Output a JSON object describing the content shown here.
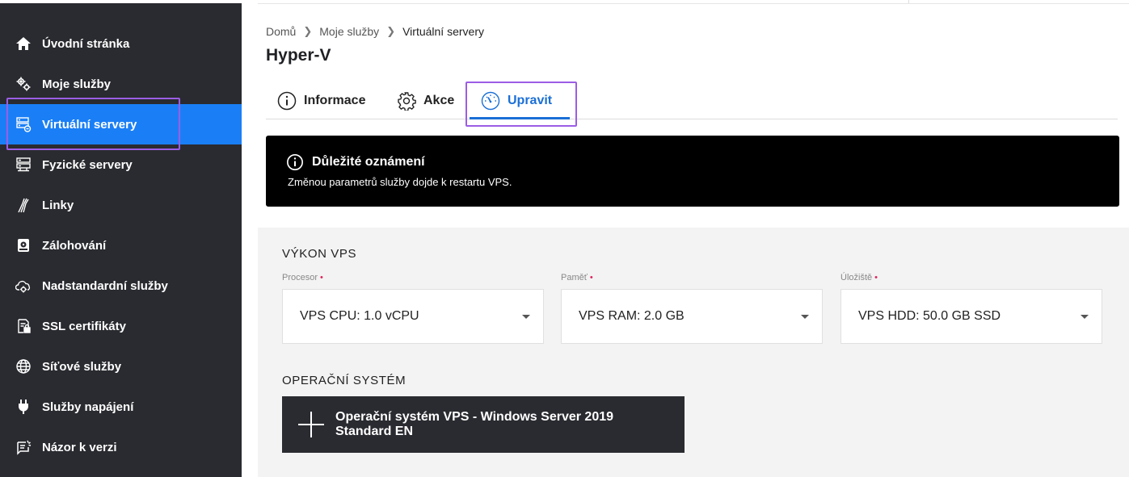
{
  "sidebar": {
    "items": [
      {
        "label": "Úvodní stránka",
        "icon": "home-icon"
      },
      {
        "label": "Moje služby",
        "icon": "gears-icon"
      },
      {
        "label": "Virtuální servery",
        "icon": "virtual-server-icon",
        "active": true
      },
      {
        "label": "Fyzické servery",
        "icon": "server-icon"
      },
      {
        "label": "Linky",
        "icon": "fiber-icon"
      },
      {
        "label": "Zálohování",
        "icon": "backup-drive-icon"
      },
      {
        "label": "Nadstandardní služby",
        "icon": "cloud-gear-icon"
      },
      {
        "label": "SSL certifikáty",
        "icon": "certificate-icon"
      },
      {
        "label": "Síťové služby",
        "icon": "globe-icon"
      },
      {
        "label": "Služby napájení",
        "icon": "power-plug-icon"
      },
      {
        "label": "Názor k verzi",
        "icon": "feedback-icon"
      }
    ]
  },
  "breadcrumb": [
    "Domů",
    "Moje služby",
    "Virtuální servery"
  ],
  "page_title": "Hyper-V",
  "tabs": [
    {
      "label": "Informace",
      "icon": "info-icon"
    },
    {
      "label": "Akce",
      "icon": "gear-icon"
    },
    {
      "label": "Upravit",
      "icon": "gauge-icon",
      "active": true
    }
  ],
  "notice": {
    "title": "Důležité oznámení",
    "text": "Změnou parametrů služby dojde k restartu VPS."
  },
  "performance": {
    "title": "VÝKON VPS",
    "fields": [
      {
        "label": "Procesor",
        "value": "VPS CPU: 1.0 vCPU"
      },
      {
        "label": "Paměť",
        "value": "VPS RAM: 2.0 GB"
      },
      {
        "label": "Úložiště",
        "value": "VPS HDD: 50.0 GB SSD"
      }
    ],
    "required_mark": "•"
  },
  "os": {
    "title": "OPERAČNÍ SYSTÉM",
    "button_label": "Operační systém VPS - Windows Server 2019 Standard EN"
  },
  "colors": {
    "sidebar_bg": "#2a2b30",
    "active_blue": "#1a7ff6",
    "highlight_purple": "#9b5de5",
    "tab_active": "#1a6fd6"
  }
}
